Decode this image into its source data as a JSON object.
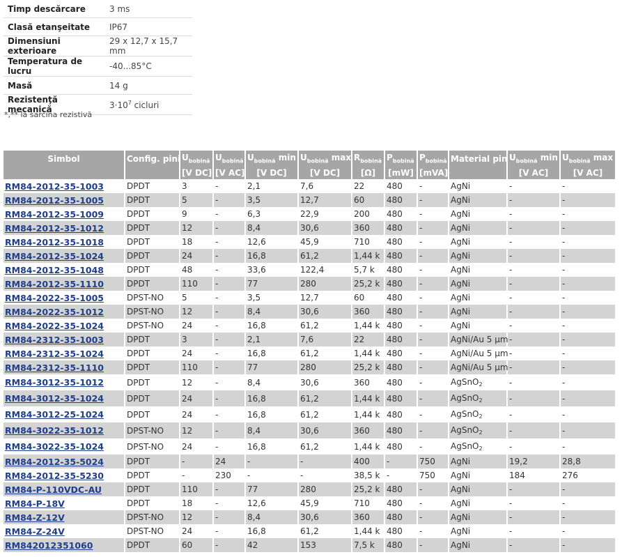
{
  "specs": [
    {
      "key": "Timp descărcare",
      "value": "3 ms"
    },
    {
      "key": "Clasă etanşeitate",
      "value": "IP67"
    },
    {
      "key": "Dimensiuni exterioare",
      "value": "29 x 12,7 x 15,7 mm"
    },
    {
      "key": "Temperatura de lucru",
      "value": "-40...85°C"
    },
    {
      "key": "Masă",
      "value": "14 g"
    },
    {
      "key": "Rezistenţă mecanică",
      "value_base": "3·10",
      "value_exp": "7",
      "value_suffix": " cicluri"
    }
  ],
  "footnote": "*,** la sarcina rezistivă",
  "table": {
    "headers": {
      "simbol": "Simbol",
      "config": "Config. pini",
      "u_main": "U",
      "u_sub": "bobină",
      "min": "min",
      "max": "max",
      "r_main": "R",
      "p_main": "P",
      "material": "Material pin"
    },
    "units": [
      "",
      "",
      "[V DC]",
      "[V AC]",
      "[V DC]",
      "[V DC]",
      "[Ω]",
      "[mW]",
      "[mVA]",
      "",
      "[V AC]",
      "[V AC]"
    ],
    "rows": [
      [
        "RM84-2012-35-1003",
        "DPDT",
        "3",
        "-",
        "2,1",
        "7,6",
        "22",
        "480",
        "-",
        "AgNi",
        "-",
        "-"
      ],
      [
        "RM84-2012-35-1005",
        "DPDT",
        "5",
        "-",
        "3,5",
        "12,7",
        "60",
        "480",
        "-",
        "AgNi",
        "-",
        "-"
      ],
      [
        "RM84-2012-35-1009",
        "DPDT",
        "9",
        "-",
        "6,3",
        "22,9",
        "200",
        "480",
        "-",
        "AgNi",
        "-",
        "-"
      ],
      [
        "RM84-2012-35-1012",
        "DPDT",
        "12",
        "-",
        "8,4",
        "30,6",
        "360",
        "480",
        "-",
        "AgNi",
        "-",
        "-"
      ],
      [
        "RM84-2012-35-1018",
        "DPDT",
        "18",
        "-",
        "12,6",
        "45,9",
        "710",
        "480",
        "-",
        "AgNi",
        "-",
        "-"
      ],
      [
        "RM84-2012-35-1024",
        "DPDT",
        "24",
        "-",
        "16,8",
        "61,2",
        "1,44 k",
        "480",
        "-",
        "AgNi",
        "-",
        "-"
      ],
      [
        "RM84-2012-35-1048",
        "DPDT",
        "48",
        "-",
        "33,6",
        "122,4",
        "5,7 k",
        "480",
        "-",
        "AgNi",
        "-",
        "-"
      ],
      [
        "RM84-2012-35-1110",
        "DPDT",
        "110",
        "-",
        "77",
        "280",
        "25,2 k",
        "480",
        "-",
        "AgNi",
        "-",
        "-"
      ],
      [
        "RM84-2022-35-1005",
        "DPST-NO",
        "5",
        "-",
        "3,5",
        "12,7",
        "60",
        "480",
        "-",
        "AgNi",
        "-",
        "-"
      ],
      [
        "RM84-2022-35-1012",
        "DPST-NO",
        "12",
        "-",
        "8,4",
        "30,6",
        "360",
        "480",
        "-",
        "AgNi",
        "-",
        "-"
      ],
      [
        "RM84-2022-35-1024",
        "DPST-NO",
        "24",
        "-",
        "16,8",
        "61,2",
        "1,44 k",
        "480",
        "-",
        "AgNi",
        "-",
        "-"
      ],
      [
        "RM84-2312-35-1003",
        "DPDT",
        "3",
        "-",
        "2,1",
        "7,6",
        "22",
        "480",
        "-",
        "AgNi/Au 5 µm",
        "-",
        "-"
      ],
      [
        "RM84-2312-35-1024",
        "DPDT",
        "24",
        "-",
        "16,8",
        "61,2",
        "1,44 k",
        "480",
        "-",
        "AgNi/Au 5 µm",
        "-",
        "-"
      ],
      [
        "RM84-2312-35-1110",
        "DPDT",
        "110",
        "-",
        "77",
        "280",
        "25,2 k",
        "480",
        "-",
        "AgNi/Au 5 µm",
        "-",
        "-"
      ],
      [
        "RM84-3012-35-1012",
        "DPDT",
        "12",
        "-",
        "8,4",
        "30,6",
        "360",
        "480",
        "-",
        "AgSnO2",
        "-",
        "-"
      ],
      [
        "RM84-3012-35-1024",
        "DPDT",
        "24",
        "-",
        "16,8",
        "61,2",
        "1,44 k",
        "480",
        "-",
        "AgSnO2",
        "-",
        "-"
      ],
      [
        "RM84-3012-25-1024",
        "DPDT",
        "24",
        "-",
        "16,8",
        "61,2",
        "1,44 k",
        "480",
        "-",
        "AgSnO2",
        "-",
        "-"
      ],
      [
        "RM84-3022-35-1012",
        "DPST-NO",
        "12",
        "-",
        "8,4",
        "30,6",
        "360",
        "480",
        "-",
        "AgSnO2",
        "-",
        "-"
      ],
      [
        "RM84-3022-35-1024",
        "DPST-NO",
        "24",
        "-",
        "16,8",
        "61,2",
        "1,44 k",
        "480",
        "-",
        "AgSnO2",
        "-",
        "-"
      ],
      [
        "RM84-2012-35-5024",
        "DPDT",
        "-",
        "24",
        "-",
        "-",
        "400",
        "-",
        "750",
        "AgNi",
        "19,2",
        "28,8"
      ],
      [
        "RM84-2012-35-5230",
        "DPDT",
        "-",
        "230",
        "-",
        "-",
        "38,5 k",
        "-",
        "750",
        "AgNi",
        "184",
        "276"
      ],
      [
        "RM84-P-110VDC-AU",
        "DPDT",
        "110",
        "-",
        "77",
        "280",
        "25,2 k",
        "480",
        "-",
        "AgNi",
        "-",
        "-"
      ],
      [
        "RM84-P-18V",
        "DPDT",
        "18",
        "-",
        "12,6",
        "45,9",
        "710",
        "480",
        "-",
        "AgNi",
        "-",
        "-"
      ],
      [
        "RM84-Z-12V",
        "DPST-NO",
        "12",
        "-",
        "8,4",
        "30,6",
        "360",
        "480",
        "-",
        "AgNi",
        "-",
        "-"
      ],
      [
        "RM84-Z-24V",
        "DPST-NO",
        "24",
        "-",
        "16,8",
        "61,2",
        "1,44 k",
        "480",
        "-",
        "AgNi",
        "-",
        "-"
      ],
      [
        "RM842012351060",
        "DPDT",
        "60",
        "-",
        "42",
        "153",
        "7,5 k",
        "480",
        "-",
        "AgNi",
        "-",
        "-"
      ]
    ]
  }
}
